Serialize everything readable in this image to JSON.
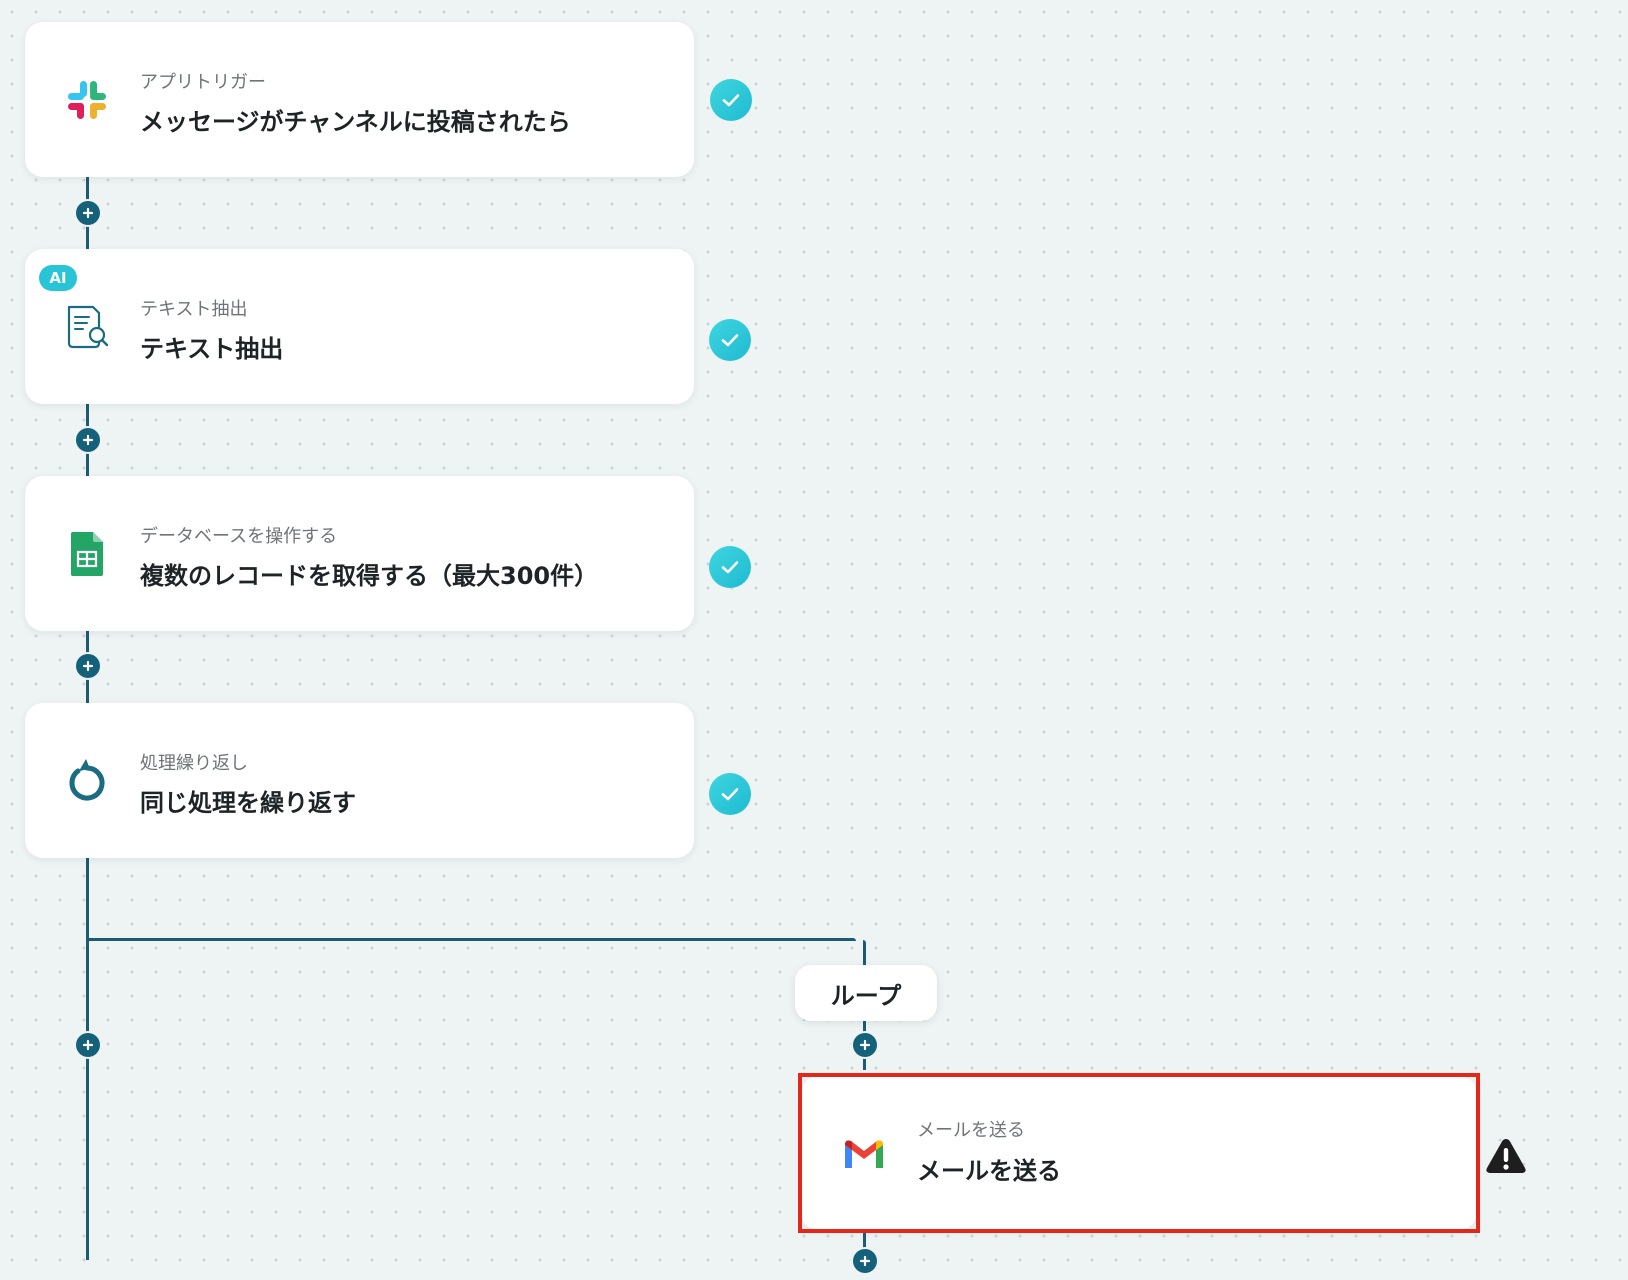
{
  "steps": [
    {
      "subtitle": "アプリトリガー",
      "title": "メッセージがチャンネルに投稿されたら",
      "icon": "slack-icon",
      "status": "completed"
    },
    {
      "badge": "AI",
      "subtitle": "テキスト抽出",
      "title": "テキスト抽出",
      "icon": "document-search-icon",
      "status": "completed"
    },
    {
      "subtitle": "データベースを操作する",
      "title": "複数のレコードを取得する（最大300件）",
      "icon": "google-sheets-icon",
      "status": "completed"
    },
    {
      "subtitle": "処理繰り返し",
      "title": "同じ処理を繰り返す",
      "icon": "loop-icon",
      "status": "completed"
    }
  ],
  "loop": {
    "label": "ループ",
    "step": {
      "subtitle": "メールを送る",
      "title": "メールを送る",
      "icon": "gmail-icon",
      "status": "warning"
    }
  },
  "colors": {
    "connector": "#1b5b73",
    "check": "#29c4d6",
    "highlight": "#e3281b",
    "background": "#eef3f3"
  }
}
